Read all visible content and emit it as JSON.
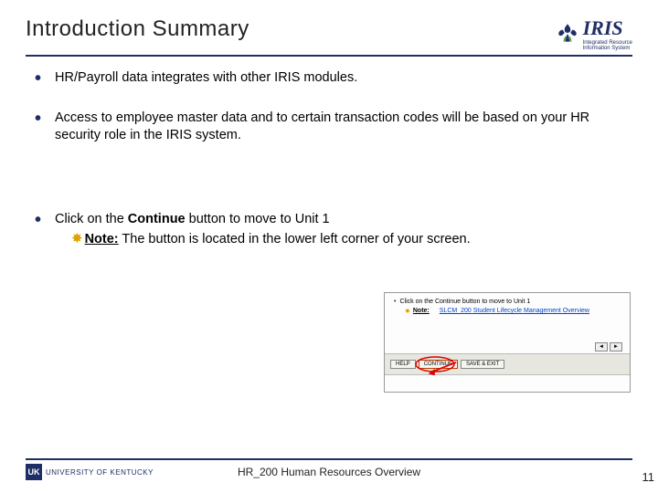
{
  "header": {
    "title": "Introduction Summary",
    "logo_text": "IRIS",
    "logo_sub1": "Integrated Resource",
    "logo_sub2": "Information System"
  },
  "bullets": {
    "b1": "HR/Payroll data integrates with other IRIS modules.",
    "b2": "Access to employee master data and to certain transaction codes will be based on your HR security role in the IRIS system.",
    "b3_pre": "Click on the ",
    "b3_bold": "Continue",
    "b3_post": " button to move to Unit 1",
    "note_label": "Note:",
    "note_text": " The button is located in the lower left corner of your screen."
  },
  "thumb": {
    "line": "Click on the Continue button to move to Unit 1",
    "note": "Note:",
    "crumb": "SLCM_200 Student Lifecycle Management Overview",
    "btn_help": "HELP",
    "btn_exit": "CONTINUE",
    "btn_save": "SAVE & EXIT",
    "nav_prev": "◄",
    "nav_next": "►"
  },
  "footer": {
    "uk_badge": "UK",
    "uk_text": "UNIVERSITY OF KENTUCKY",
    "center": "HR_200 Human Resources Overview",
    "page": "11"
  }
}
